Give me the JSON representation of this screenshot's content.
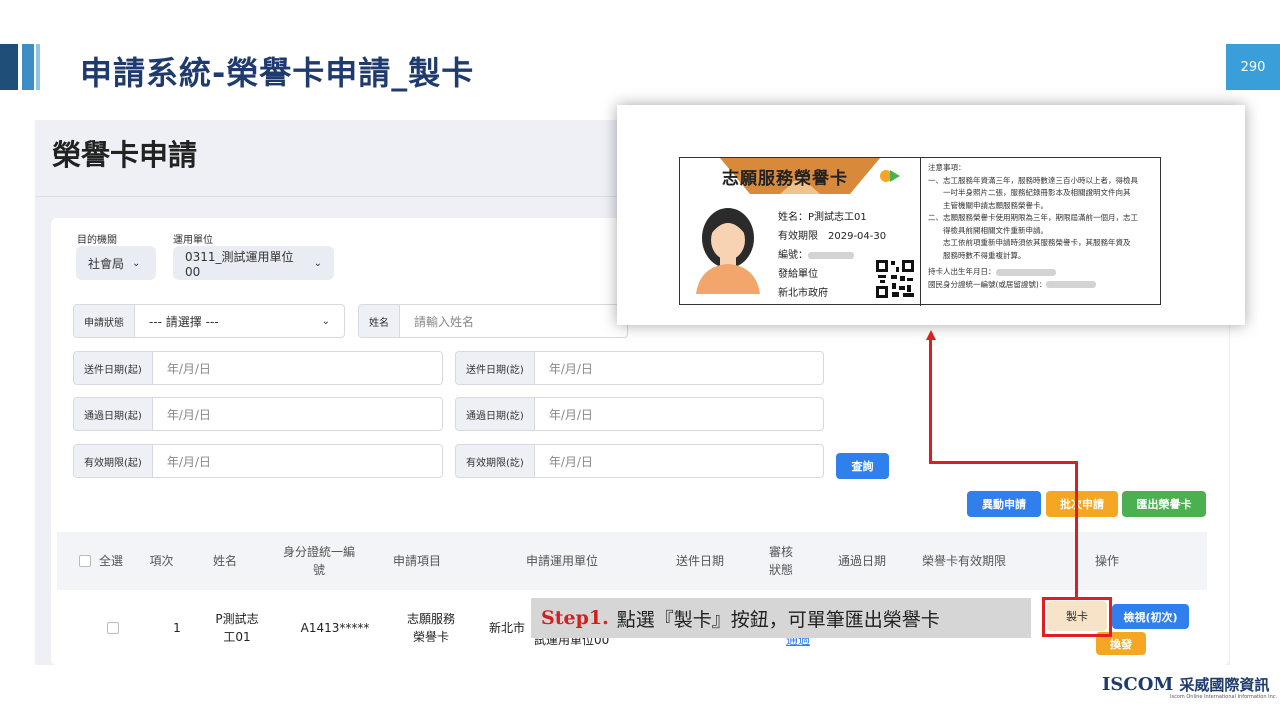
{
  "slide": {
    "title": "申請系統-榮譽卡申請_製卡",
    "page_number": "290"
  },
  "app": {
    "title": "榮譽卡申請",
    "filters": {
      "agency_label": "目的機關",
      "agency_value": "社會局",
      "unit_label": "運用單位",
      "unit_value": "0311_測試運用單位00",
      "status_label": "申請狀態",
      "status_value": "--- 請選擇 ---",
      "name_label": "姓名",
      "name_placeholder": "請輸入姓名",
      "date_placeholder": "年/月/日",
      "send_start_label": "送件日期(起)",
      "send_end_label": "送件日期(訖)",
      "pass_start_label": "通過日期(起)",
      "pass_end_label": "通過日期(訖)",
      "valid_start_label": "有效期限(起)",
      "valid_end_label": "有效期限(訖)",
      "query_button": "查詢"
    },
    "actions": {
      "change_apply": "異動申請",
      "batch_apply": "批次申請",
      "export_card": "匯出榮譽卡"
    },
    "table": {
      "headers": {
        "select_all": "全選",
        "item": "項次",
        "name": "姓名",
        "id": "身分證統一編號",
        "apply_item": "申請項目",
        "apply_unit": "申請運用單位",
        "send_date": "送件日期",
        "review_status": "審核狀態",
        "pass_date": "通過日期",
        "valid_until": "榮譽卡有效期限",
        "operations": "操作"
      },
      "rows": [
        {
          "item": "1",
          "name": "P測試志工01",
          "id": "A1413*****",
          "apply_item": "志願服務榮譽卡",
          "apply_unit_prefix": "新北市",
          "apply_unit_suffix": "試運用單位00",
          "review_link": "通過",
          "make_card": "製卡",
          "view": "檢視(初次)",
          "replace": "換發"
        }
      ]
    }
  },
  "card_preview": {
    "header": "志願服務榮譽卡",
    "name_line": "姓名：P測試志工01",
    "valid_line": "有效期限　2029-04-30",
    "number_line": "編號：",
    "issuer_label": "發給單位",
    "issuer_value": "新北市政府",
    "notes_title": "注意事項：",
    "note_1": "一、志工服務年資滿三年，服務時數達三百小時以上者，得檢具",
    "note_1b": "　　一吋半身照片二張，服務紀錄冊影本及相關證明文件向其",
    "note_1c": "　　主管機關申請志願服務榮譽卡。",
    "note_2": "二、志願服務榮譽卡使用期限為三年，期限屆滿前一個月，志工",
    "note_2b": "　　得檢具前開相關文件重新申請。",
    "note_2c": "　　志工依前項重新申請時須依其服務榮譽卡，其服務年資及",
    "note_2d": "　　服務時數不得重複計算。",
    "holder_birth": "持卡人出生年月日：",
    "holder_id": "國民身分證統一編號(或居留證號)："
  },
  "callout": {
    "step": "Step1.",
    "text": "點選『製卡』按鈕，可單筆匯出榮譽卡"
  },
  "logo": {
    "en": "ISCOM",
    "zh": "采威國際資訊",
    "sub": "Iscom Online International Information Inc."
  },
  "colors": {
    "title_navy": "#1f3b6e",
    "accent_blue": "#2f80ed",
    "accent_orange": "#f5a623",
    "accent_green": "#4caf50",
    "highlight_red": "#d91f1f"
  }
}
